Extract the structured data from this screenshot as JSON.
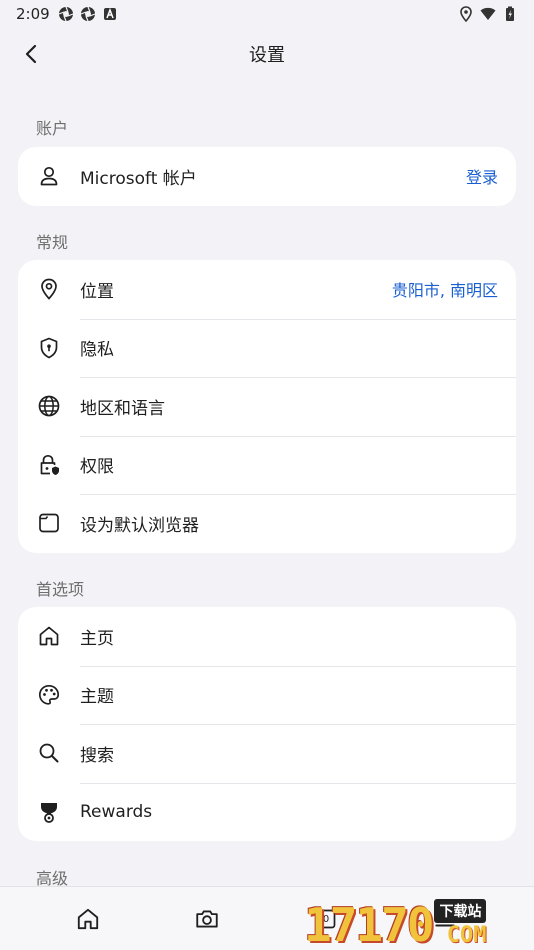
{
  "status": {
    "time": "2:09",
    "notification_icons": [
      "aperture-icon",
      "aperture-icon",
      "a-letter-icon"
    ],
    "system_icons": [
      "location-icon",
      "wifi-icon",
      "battery-icon"
    ]
  },
  "header": {
    "title": "设置"
  },
  "sections": {
    "account": {
      "title": "账户",
      "items": [
        {
          "label": "Microsoft 帐户",
          "value": "登录",
          "icon": "person-icon"
        }
      ]
    },
    "general": {
      "title": "常规",
      "items": [
        {
          "label": "位置",
          "value": "贵阳市, 南明区",
          "icon": "location-pin-icon"
        },
        {
          "label": "隐私",
          "icon": "shield-icon"
        },
        {
          "label": "地区和语言",
          "icon": "globe-icon"
        },
        {
          "label": "权限",
          "icon": "lock-shield-icon"
        },
        {
          "label": "设为默认浏览器",
          "icon": "browser-window-icon"
        }
      ]
    },
    "preferences": {
      "title": "首选项",
      "items": [
        {
          "label": "主页",
          "icon": "home-icon"
        },
        {
          "label": "主题",
          "icon": "palette-icon"
        },
        {
          "label": "搜索",
          "icon": "search-icon"
        },
        {
          "label": "Rewards",
          "icon": "trophy-icon"
        }
      ]
    },
    "advanced": {
      "title": "高级"
    }
  },
  "bottom_nav": {
    "tab_count": "0",
    "items": [
      "home-icon",
      "camera-icon",
      "tabs-icon",
      "menu-icon"
    ]
  },
  "watermark": {
    "digits": "17170",
    "badge": "下载站",
    "suffix": "COM"
  },
  "colors": {
    "accent": "#1a5fd1",
    "background": "#f3f3f7",
    "card": "#ffffff"
  }
}
